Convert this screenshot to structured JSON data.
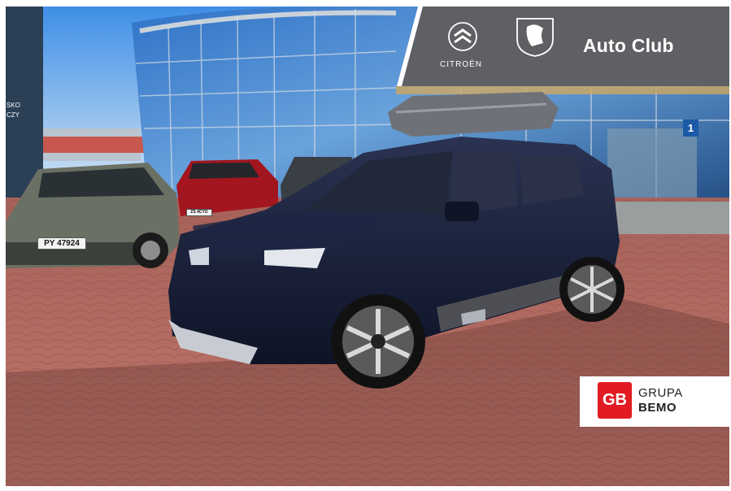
{
  "banner": {
    "citroen_word": "CITROËN",
    "title": "Auto Club"
  },
  "photo": {
    "plate_left": "PY 47924",
    "plate_red": "ZS 4CYO",
    "plate_main_line1": "",
    "plate_main_line2": "",
    "side_sign_line1": "SKO",
    "side_sign_line2": "CZY",
    "door_sign": "1"
  },
  "partner": {
    "mark": "GB",
    "line1": "GRUPA",
    "line2": "BEMO"
  },
  "colors": {
    "banner_bg": "#5f6063",
    "gb_red": "#e21b22",
    "sky": "#8fb9e6",
    "car_main": "#141b33",
    "pavement": "#b5685e"
  }
}
